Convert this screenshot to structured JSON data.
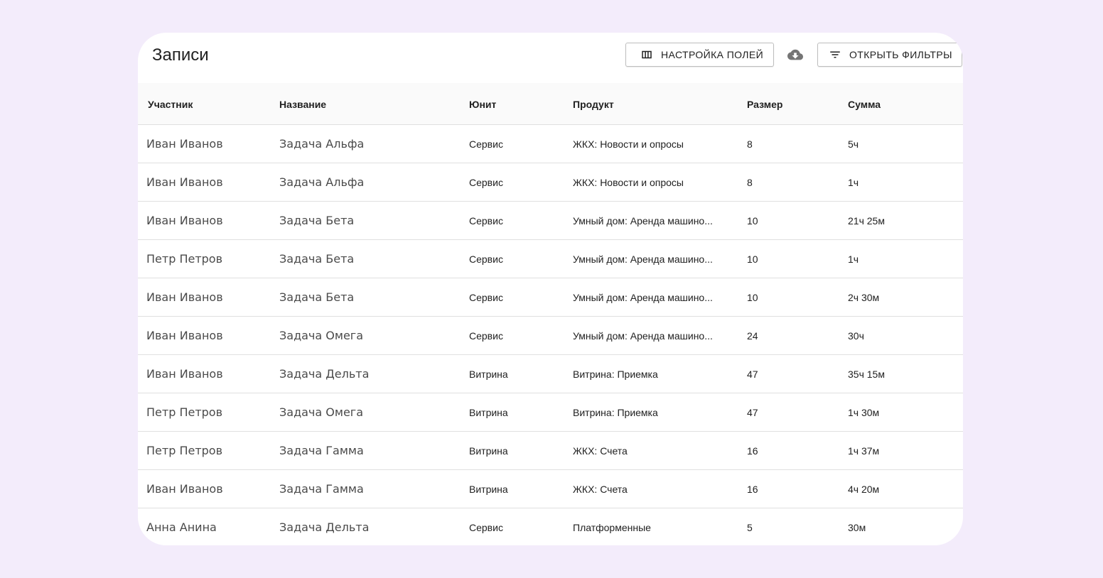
{
  "header": {
    "title": "Записи",
    "fields_button": "НАСТРОЙКА ПОЛЕЙ",
    "filters_button": "ОТКРЫТЬ ФИЛЬТРЫ",
    "icons": {
      "fields": "view-column-icon",
      "download": "cloud-download-icon",
      "filters": "filter-list-icon"
    }
  },
  "table": {
    "columns": [
      "Участник",
      "Название",
      "Юнит",
      "Продукт",
      "Размер",
      "Сумма"
    ],
    "rows": [
      [
        "Иван Иванов",
        "Задача Альфа",
        "Сервис",
        "ЖКХ: Новости и опросы",
        "8",
        "5ч"
      ],
      [
        "Иван Иванов",
        "Задача Альфа",
        "Сервис",
        "ЖКХ: Новости и опросы",
        "8",
        "1ч"
      ],
      [
        "Иван Иванов",
        "Задача Бета",
        "Сервис",
        "Умный дом: Аренда машино...",
        "10",
        "21ч 25м"
      ],
      [
        "Петр Петров",
        "Задача Бета",
        "Сервис",
        "Умный дом: Аренда машино...",
        "10",
        "1ч"
      ],
      [
        "Иван Иванов",
        "Задача Бета",
        "Сервис",
        "Умный дом: Аренда машино...",
        "10",
        "2ч 30м"
      ],
      [
        "Иван Иванов",
        "Задача Омега",
        "Сервис",
        "Умный дом: Аренда машино...",
        "24",
        "30ч"
      ],
      [
        "Иван Иванов",
        "Задача Дельта",
        "Витрина",
        "Витрина: Приемка",
        "47",
        "35ч 15м"
      ],
      [
        "Петр Петров",
        "Задача Омега",
        "Витрина",
        "Витрина: Приемка",
        "47",
        "1ч 30м"
      ],
      [
        "Петр Петров",
        "Задача Гамма",
        "Витрина",
        "ЖКХ: Счета",
        "16",
        "1ч 37м"
      ],
      [
        "Иван Иванов",
        "Задача Гамма",
        "Витрина",
        "ЖКХ: Счета",
        "16",
        "4ч 20м"
      ],
      [
        "Анна Анина",
        "Задача Дельта",
        "Сервис",
        "Платформенные",
        "5",
        "30м"
      ]
    ]
  }
}
